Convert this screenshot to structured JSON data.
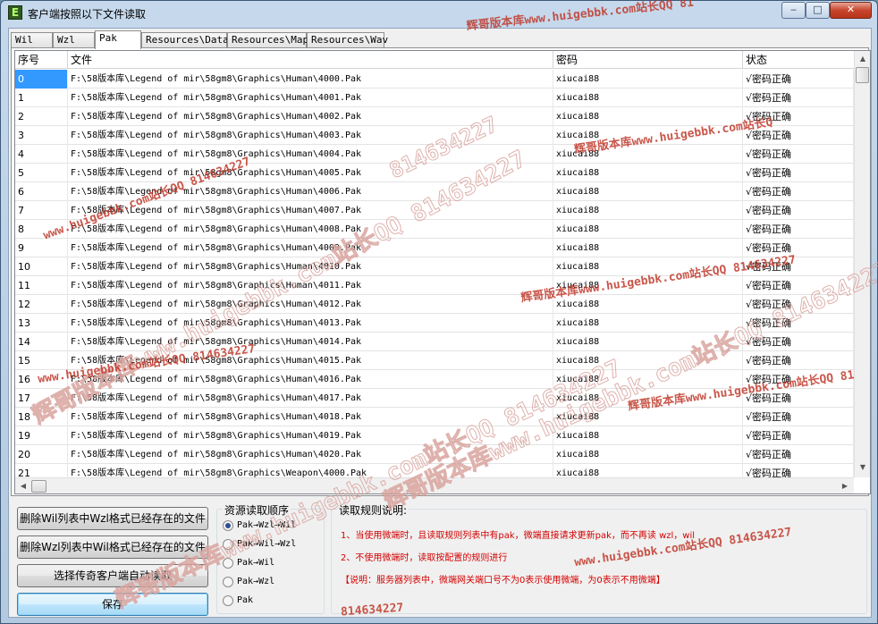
{
  "window": {
    "title": "客户端按照以下文件读取",
    "icon_glyph": "E",
    "controls": {
      "min": "‒",
      "max": "□",
      "close": "✕"
    }
  },
  "tabs": [
    "Wil",
    "Wzl",
    "Pak",
    "Resources\\Data",
    "Resources\\Map",
    "Resources\\Wav"
  ],
  "active_tab": "Pak",
  "table": {
    "headers": [
      "序号",
      "文件",
      "密码",
      "状态"
    ],
    "rows": [
      {
        "no": "0",
        "file": "F:\\58版本库\\Legend of mir\\58gm8\\Graphics\\Human\\4000.Pak",
        "pwd": "xiucai88",
        "status": "√密码正确"
      },
      {
        "no": "1",
        "file": "F:\\58版本库\\Legend of mir\\58gm8\\Graphics\\Human\\4001.Pak",
        "pwd": "xiucai88",
        "status": "√密码正确"
      },
      {
        "no": "2",
        "file": "F:\\58版本库\\Legend of mir\\58gm8\\Graphics\\Human\\4002.Pak",
        "pwd": "xiucai88",
        "status": "√密码正确"
      },
      {
        "no": "3",
        "file": "F:\\58版本库\\Legend of mir\\58gm8\\Graphics\\Human\\4003.Pak",
        "pwd": "xiucai88",
        "status": "√密码正确"
      },
      {
        "no": "4",
        "file": "F:\\58版本库\\Legend of mir\\58gm8\\Graphics\\Human\\4004.Pak",
        "pwd": "xiucai88",
        "status": "√密码正确"
      },
      {
        "no": "5",
        "file": "F:\\58版本库\\Legend of mir\\58gm8\\Graphics\\Human\\4005.Pak",
        "pwd": "xiucai88",
        "status": "√密码正确"
      },
      {
        "no": "6",
        "file": "F:\\58版本库\\Legend of mir\\58gm8\\Graphics\\Human\\4006.Pak",
        "pwd": "xiucai88",
        "status": "√密码正确"
      },
      {
        "no": "7",
        "file": "F:\\58版本库\\Legend of mir\\58gm8\\Graphics\\Human\\4007.Pak",
        "pwd": "xiucai88",
        "status": "√密码正确"
      },
      {
        "no": "8",
        "file": "F:\\58版本库\\Legend of mir\\58gm8\\Graphics\\Human\\4008.Pak",
        "pwd": "xiucai88",
        "status": "√密码正确"
      },
      {
        "no": "9",
        "file": "F:\\58版本库\\Legend of mir\\58gm8\\Graphics\\Human\\4009.Pak",
        "pwd": "xiucai88",
        "status": "√密码正确"
      },
      {
        "no": "10",
        "file": "F:\\58版本库\\Legend of mir\\58gm8\\Graphics\\Human\\4010.Pak",
        "pwd": "xiucai88",
        "status": "√密码正确"
      },
      {
        "no": "11",
        "file": "F:\\58版本库\\Legend of mir\\58gm8\\Graphics\\Human\\4011.Pak",
        "pwd": "xiucai88",
        "status": "√密码正确"
      },
      {
        "no": "12",
        "file": "F:\\58版本库\\Legend of mir\\58gm8\\Graphics\\Human\\4012.Pak",
        "pwd": "xiucai88",
        "status": "√密码正确"
      },
      {
        "no": "13",
        "file": "F:\\58版本库\\Legend of mir\\58gm8\\Graphics\\Human\\4013.Pak",
        "pwd": "xiucai88",
        "status": "√密码正确"
      },
      {
        "no": "14",
        "file": "F:\\58版本库\\Legend of mir\\58gm8\\Graphics\\Human\\4014.Pak",
        "pwd": "xiucai88",
        "status": "√密码正确"
      },
      {
        "no": "15",
        "file": "F:\\58版本库\\Legend of mir\\58gm8\\Graphics\\Human\\4015.Pak",
        "pwd": "xiucai88",
        "status": "√密码正确"
      },
      {
        "no": "16",
        "file": "F:\\58版本库\\Legend of mir\\58gm8\\Graphics\\Human\\4016.Pak",
        "pwd": "xiucai88",
        "status": "√密码正确"
      },
      {
        "no": "17",
        "file": "F:\\58版本库\\Legend of mir\\58gm8\\Graphics\\Human\\4017.Pak",
        "pwd": "xiucai88",
        "status": "√密码正确"
      },
      {
        "no": "18",
        "file": "F:\\58版本库\\Legend of mir\\58gm8\\Graphics\\Human\\4018.Pak",
        "pwd": "xiucai88",
        "status": "√密码正确"
      },
      {
        "no": "19",
        "file": "F:\\58版本库\\Legend of mir\\58gm8\\Graphics\\Human\\4019.Pak",
        "pwd": "xiucai88",
        "status": "√密码正确"
      },
      {
        "no": "20",
        "file": "F:\\58版本库\\Legend of mir\\58gm8\\Graphics\\Human\\4020.Pak",
        "pwd": "xiucai88",
        "status": "√密码正确"
      },
      {
        "no": "21",
        "file": "F:\\58版本库\\Legend of mir\\58gm8\\Graphics\\Weapon\\4000.Pak",
        "pwd": "xiucai88",
        "status": "√密码正确"
      }
    ]
  },
  "buttons": {
    "delete_wil": "删除Wil列表中Wzl格式已经存在的文件",
    "delete_wzl": "删除Wzl列表中Wil格式已经存在的文件",
    "auto_read": "选择传奇客户端自动读取",
    "save": "保存"
  },
  "order_group": {
    "label": "资源读取顺序",
    "options": [
      "Pak→Wzl→Wil",
      "Pak→Wil→Wzl",
      "Pak→Wil",
      "Pak→Wzl",
      "Pak"
    ],
    "selected": "Pak→Wzl→Wil"
  },
  "rules": {
    "label": "读取规则说明:",
    "line1": "1、当使用微端时，且读取规则列表中有pak，微端直接请求更新pak，而不再读 wzl，wil",
    "line2": "2、不使用微端时，读取按配置的规则进行",
    "line3": "【说明：服务器列表中，微端网关端口号不为0表示使用微端，为0表示不用微端】"
  },
  "watermarks": {
    "a": "辉哥版本库www.huigebbk.com站长QQ 814634227",
    "b": "814634227",
    "c": "辉哥版本库www.huigebbk.com站长QQ 81",
    "d": "www.huigebbk.com站长QQ 814634227",
    "e": "辉哥版本库www.huigebbk.com站长Q"
  },
  "colors": {
    "selection": "#3399ff",
    "rule_text": "#d40000",
    "watermark": "#c0392b"
  }
}
